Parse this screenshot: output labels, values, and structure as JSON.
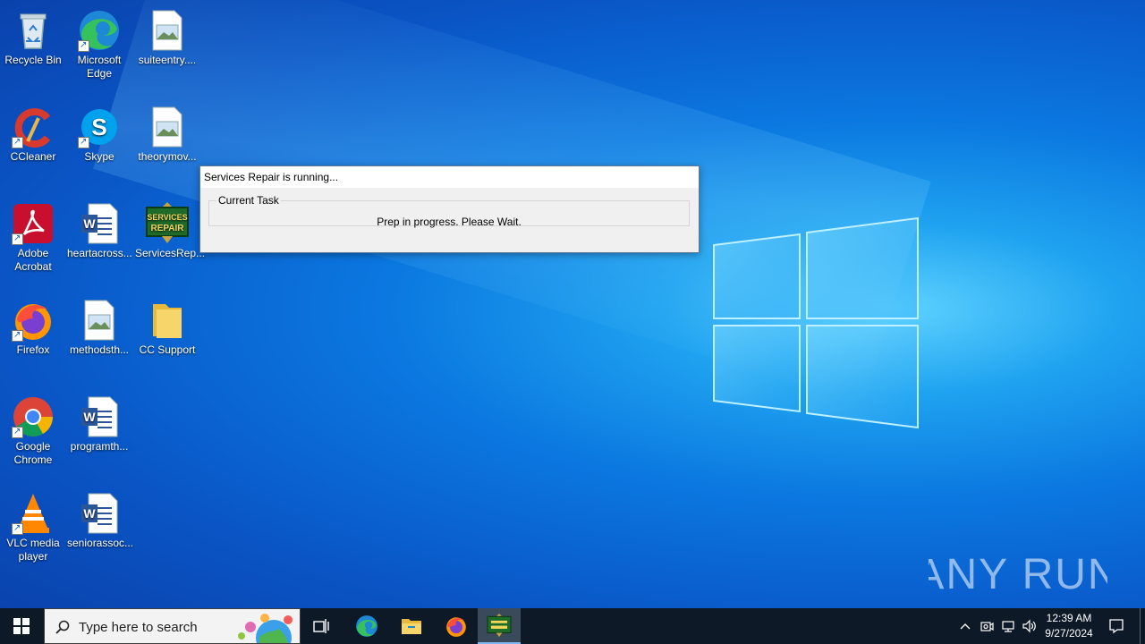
{
  "desktop": {
    "icons": [
      {
        "label": "Recycle Bin",
        "icon": "recycle-bin-icon"
      },
      {
        "label": "Microsoft Edge",
        "icon": "edge-icon"
      },
      {
        "label": "suiteentry....",
        "icon": "image-file-icon"
      },
      {
        "label": "CCleaner",
        "icon": "ccleaner-icon"
      },
      {
        "label": "Skype",
        "icon": "skype-icon"
      },
      {
        "label": "theorymov...",
        "icon": "image-file-icon"
      },
      {
        "label": "Adobe Acrobat",
        "icon": "acrobat-icon"
      },
      {
        "label": "heartacross...",
        "icon": "word-doc-icon"
      },
      {
        "label": "ServicesRep...",
        "icon": "services-repair-icon",
        "badge_line1": "SERVICES",
        "badge_line2": "REPAIR"
      },
      {
        "label": "Firefox",
        "icon": "firefox-icon"
      },
      {
        "label": "methodsth...",
        "icon": "image-file-icon"
      },
      {
        "label": "CC Support",
        "icon": "folder-icon"
      },
      {
        "label": "Google Chrome",
        "icon": "chrome-icon"
      },
      {
        "label": "programth...",
        "icon": "word-doc-icon"
      },
      {
        "label": "VLC media player",
        "icon": "vlc-icon"
      },
      {
        "label": "seniorassoc...",
        "icon": "word-doc-icon"
      }
    ]
  },
  "dialog": {
    "title": "Services Repair is running...",
    "group_label": "Current Task",
    "task_text": "Prep in progress.  Please Wait."
  },
  "watermark": {
    "text": "ANY RUN"
  },
  "taskbar": {
    "search_placeholder": "Type here to search",
    "clock_time": "12:39 AM",
    "clock_date": "9/27/2024",
    "apps": [
      "task-view-icon",
      "edge-icon",
      "file-explorer-icon",
      "firefox-icon",
      "services-repair-icon"
    ]
  },
  "colors": {
    "taskbar": "#0d1926",
    "desktop_accent": "#0b78e0",
    "dialog_bg": "#f0f0f0"
  }
}
